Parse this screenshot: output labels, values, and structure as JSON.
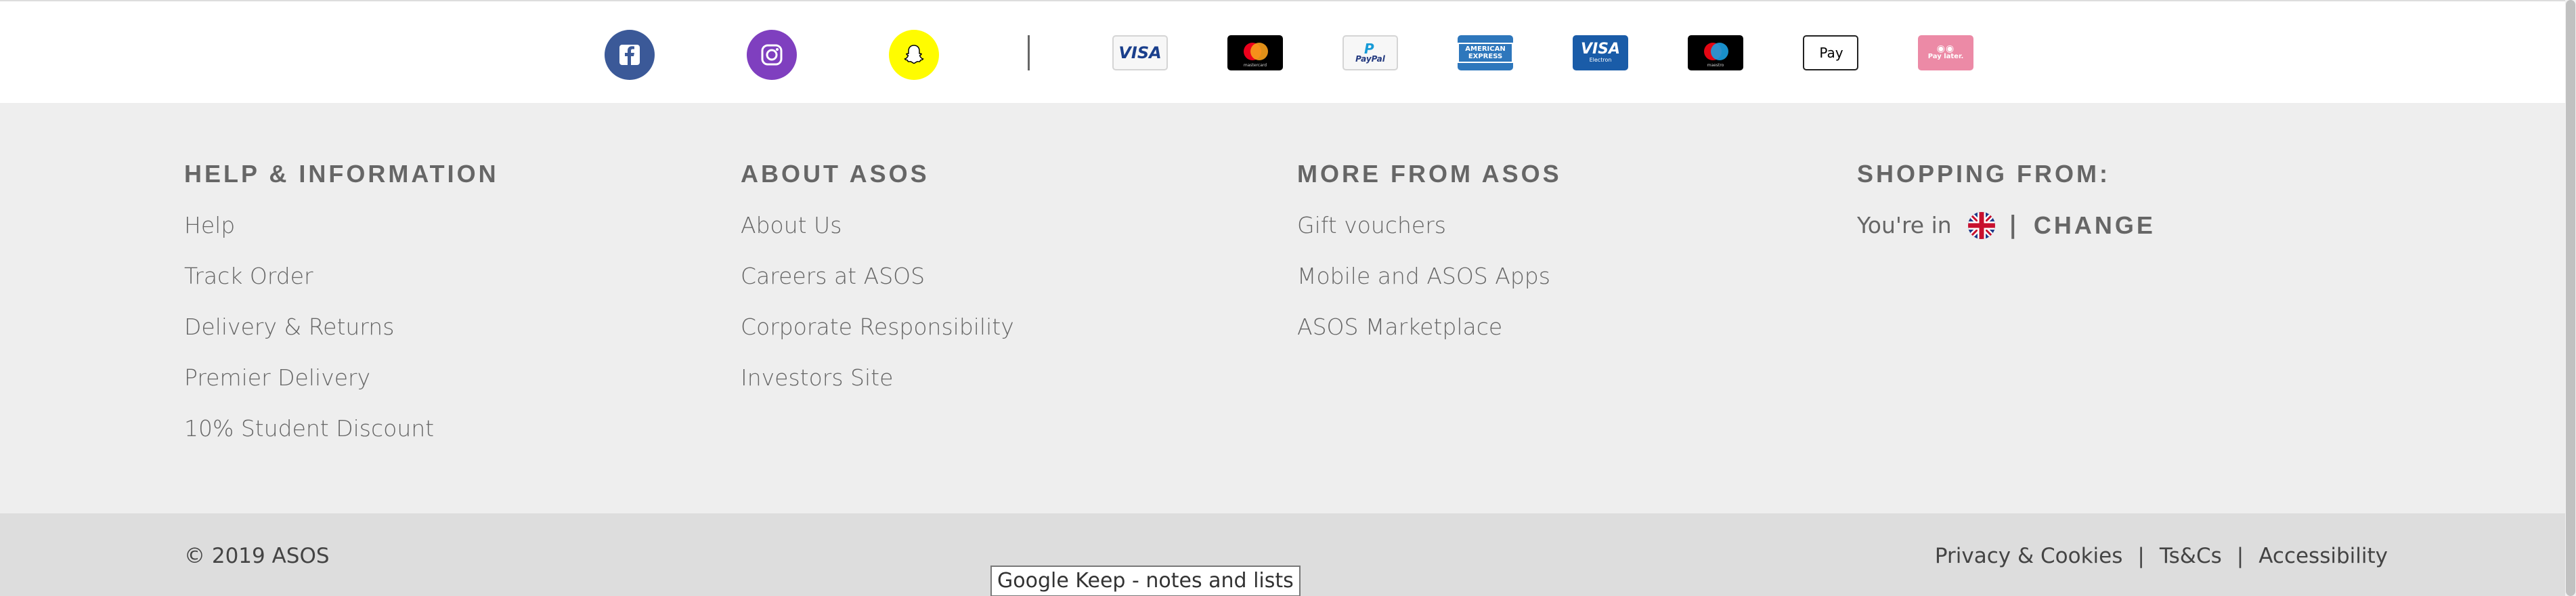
{
  "social": {
    "facebook": {
      "icon": "facebook-icon",
      "color": "#3b5998"
    },
    "instagram": {
      "icon": "instagram-icon",
      "color": "#7f3fbf"
    },
    "snapchat": {
      "icon": "snapchat-icon",
      "color": "#fffc00"
    }
  },
  "payments": {
    "visa": "VISA",
    "mastercard_caption": "mastercard",
    "paypal": "PayPal",
    "amex": "AMERICAN EXPRESS",
    "visa_debit": "VISA",
    "visa_debit_caption": "Electron",
    "maestro_caption": "maestro",
    "applepay": "Pay",
    "clearpay_caption": "Pay later."
  },
  "footer": {
    "help": {
      "heading": "HELP & INFORMATION",
      "items": [
        "Help",
        "Track Order",
        "Delivery & Returns",
        "Premier Delivery",
        "10% Student Discount"
      ]
    },
    "about": {
      "heading": "ABOUT ASOS",
      "items": [
        "About Us",
        "Careers at ASOS",
        "Corporate Responsibility",
        "Investors Site"
      ]
    },
    "more": {
      "heading": "MORE FROM ASOS",
      "items": [
        "Gift vouchers",
        "Mobile and ASOS Apps",
        "ASOS Marketplace"
      ]
    },
    "shopping": {
      "heading": "SHOPPING FROM:",
      "youre_in": "You're in",
      "separator": "|",
      "change": "CHANGE",
      "flag_icon": "uk-flag-icon"
    }
  },
  "bottom": {
    "copyright": "© 2019 ASOS",
    "links": [
      "Privacy & Cookies",
      "Ts&Cs",
      "Accessibility"
    ],
    "separator": "|"
  },
  "tooltip": "Google Keep - notes and lists",
  "colors": {
    "footer_bg": "#eeeeee",
    "bottom_bg": "#dddddd",
    "text": "#666666"
  }
}
